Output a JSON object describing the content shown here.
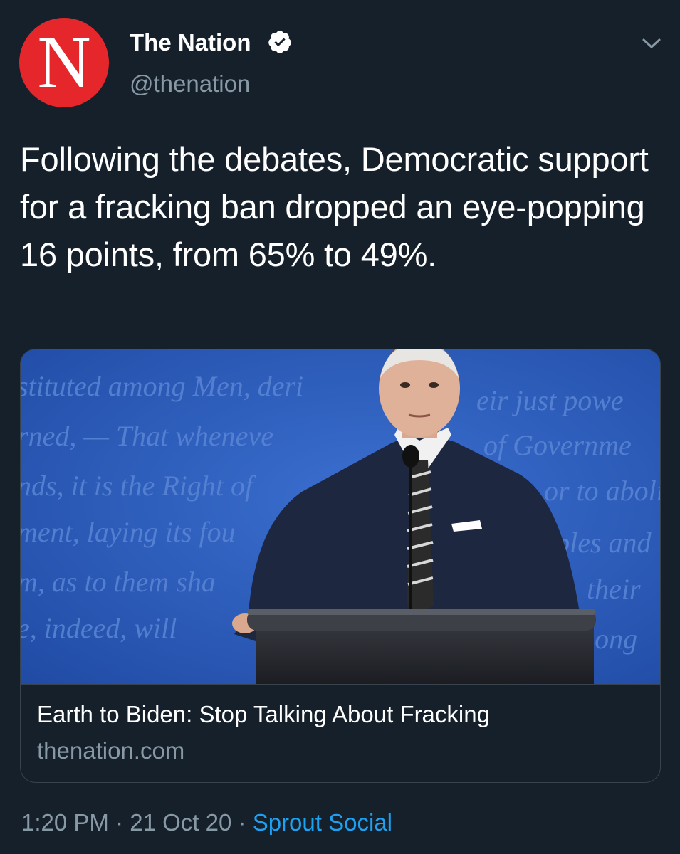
{
  "author": {
    "avatar_letter": "N",
    "display_name": "The Nation",
    "handle": "@thenation",
    "verified": true
  },
  "tweet": {
    "text": "Following the debates, Democratic support for a fracking ban dropped an eye-popping 16 points, from 65% to 49%."
  },
  "card": {
    "image_icon": "photo-of-speaker-at-podium",
    "background_script_lines": [
      "stituted among Men, deri",
      "eir just powe",
      "rned, — That wheneve",
      "of Governme",
      "nds, it is the Right of",
      "or to aboli",
      "ment, laying its fou",
      "iples and",
      "m, as to them sha",
      "their",
      "e, indeed, will",
      "long"
    ],
    "title": "Earth to Biden: Stop Talking About Fracking",
    "domain": "thenation.com"
  },
  "footer": {
    "time": "1:20 PM",
    "separator": "·",
    "date": "21 Oct 20",
    "source": "Sprout Social"
  },
  "colors": {
    "background": "#15202b",
    "brand_red": "#e5262b",
    "secondary_text": "#8899a6",
    "link_blue": "#1da1f2",
    "border": "#38444d"
  }
}
